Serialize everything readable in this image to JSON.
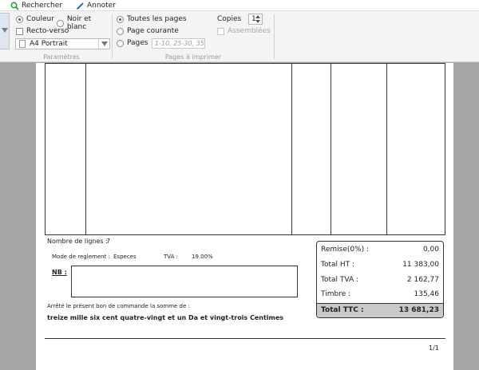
{
  "toolbar": {
    "search_label": "Rechercher",
    "annotate_label": "Annoter"
  },
  "print_settings": {
    "color_options": [
      {
        "label": "Couleur",
        "selected": true
      },
      {
        "label": "Noir et blanc",
        "selected": false
      }
    ],
    "duplex_label": "Recto-verso",
    "paper_value": "A4 Portrait",
    "group_params_caption": "Paramètres",
    "pages_options": [
      {
        "label": "Toutes les pages",
        "selected": true
      },
      {
        "label": "Page courante",
        "selected": false
      },
      {
        "label": "Pages",
        "selected": false
      }
    ],
    "pages_placeholder": "1-10, 25-30, 35",
    "group_pages_caption": "Pages à imprimer",
    "copies_label": "Copies",
    "copies_value": "1",
    "collate_label": "Assemblées"
  },
  "document": {
    "line_count_label": "Nombre de lignes :",
    "line_count_value": "7",
    "payment_mode_label": "Mode de reglement :",
    "payment_mode_value": "Especes",
    "vat_label": "TVA :",
    "vat_value": "19.00%",
    "nb_label": "NB :",
    "amount_intro": "Arrêté le présent bon de commande  la somme de :",
    "amount_words": "treize mille six cent quatre-vingt et un Da et vingt-trois Centimes",
    "totals": [
      {
        "label": "Remise(0%) :",
        "value": "0,00"
      },
      {
        "label": "Total HT :",
        "value": "11 383,00"
      },
      {
        "label": "Total TVA :",
        "value": "2 162,77"
      },
      {
        "label": "Timbre :",
        "value": "135,46"
      }
    ],
    "grand_total_label": "Total TTC :",
    "grand_total_value": "13 681,23",
    "page_number": "1/1"
  },
  "colors": {
    "accent_blue": "#1f6fb5",
    "search_icon": "#2e9a3a",
    "preview_bg": "#a6a6a6",
    "grand_total_bg": "#c9c9c9"
  },
  "icons": [
    "search-icon",
    "pen-icon",
    "chevron-down-icon",
    "document-icon"
  ]
}
